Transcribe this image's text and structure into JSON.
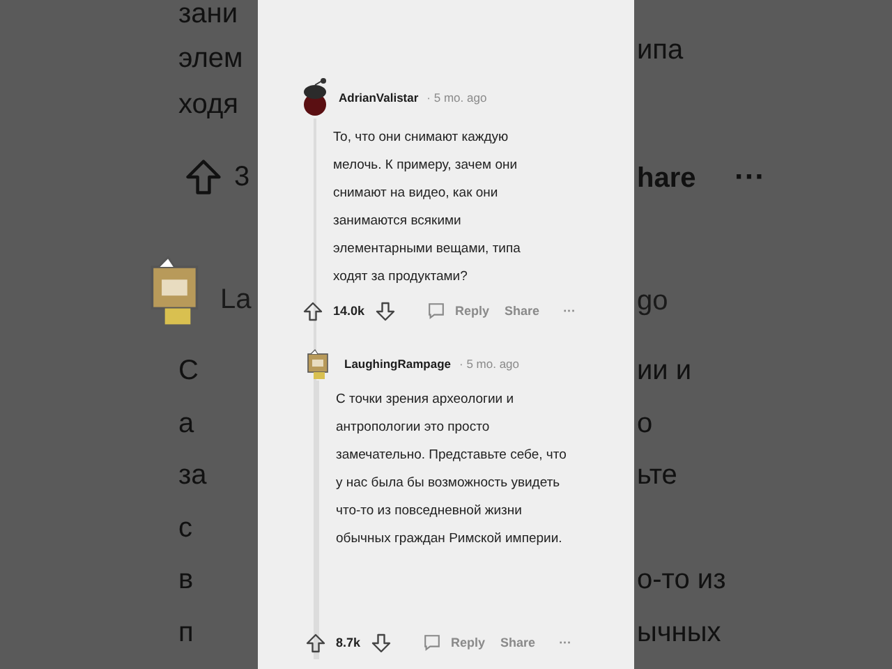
{
  "backdrop_left": {
    "rows": [
      {
        "kind": "text",
        "text": "зани"
      },
      {
        "kind": "text",
        "text": "элем"
      },
      {
        "kind": "text",
        "text": "ходя"
      },
      {
        "kind": "vote",
        "text": "3"
      },
      {
        "kind": "user",
        "text": "La"
      },
      {
        "kind": "text",
        "text": "С"
      },
      {
        "kind": "text",
        "text": "а"
      },
      {
        "kind": "text",
        "text": "за"
      },
      {
        "kind": "text",
        "text": "с"
      },
      {
        "kind": "text",
        "text": "в"
      },
      {
        "kind": "text",
        "text": "п"
      }
    ]
  },
  "backdrop_right": {
    "rows": [
      {
        "kind": "text",
        "text": "ипа"
      },
      {
        "kind": "action",
        "text": "hare",
        "more": "···"
      },
      {
        "kind": "meta",
        "text": "go"
      },
      {
        "kind": "text",
        "text": "ии и"
      },
      {
        "kind": "text",
        "text": "о"
      },
      {
        "kind": "text",
        "text": "ьте"
      },
      {
        "kind": "text",
        "text": "о-то из"
      },
      {
        "kind": "text",
        "text": "ычных"
      }
    ]
  },
  "comments": [
    {
      "author": "AdrianValistar",
      "age": "· 5 mo. ago",
      "body": "То, что они снимают каждую мелочь. К примеру, зачем они снимают на видео, как они занимаются всякими элементарными вещами, типа ходят за продуктами?",
      "score": "14.0k",
      "reply": "Reply",
      "share": "Share",
      "more": "···",
      "replies": [
        {
          "author": "LaughingRampage",
          "age": "· 5 mo. ago",
          "body": "С точки зрения археологии и антропологии это просто замечательно. Представьте себе, что у нас была бы возможность увидеть что-то из повседневной жизни обычных граждан Римской империи.",
          "score": "8.7k",
          "reply": "Reply",
          "share": "Share",
          "more": "···"
        }
      ]
    }
  ]
}
